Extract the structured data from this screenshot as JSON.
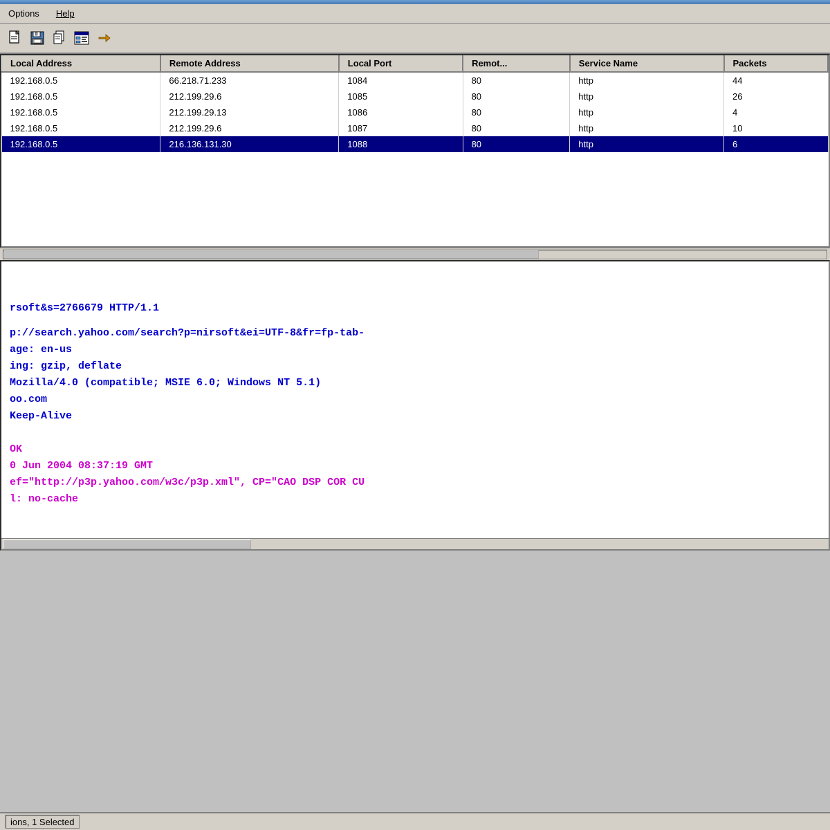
{
  "titlebar": {
    "gradient": true
  },
  "menubar": {
    "items": [
      {
        "label": "Options",
        "underline": false
      },
      {
        "label": "Help",
        "underline": true
      }
    ]
  },
  "toolbar": {
    "buttons": [
      {
        "id": "new",
        "icon": "new-doc-icon",
        "label": "New"
      },
      {
        "id": "save",
        "icon": "save-icon",
        "label": "Save"
      },
      {
        "id": "copy",
        "icon": "copy-icon",
        "label": "Copy"
      },
      {
        "id": "properties",
        "icon": "properties-icon",
        "label": "Properties"
      },
      {
        "id": "exit",
        "icon": "exit-icon",
        "label": "Exit"
      }
    ]
  },
  "table": {
    "columns": [
      {
        "id": "local_address",
        "label": "Local Address"
      },
      {
        "id": "remote_address",
        "label": "Remote Address"
      },
      {
        "id": "local_port",
        "label": "Local Port"
      },
      {
        "id": "remote_port",
        "label": "Remot..."
      },
      {
        "id": "service_name",
        "label": "Service Name"
      },
      {
        "id": "packets",
        "label": "Packets"
      }
    ],
    "rows": [
      {
        "local_address": "192.168.0.5",
        "remote_address": "66.218.71.233",
        "local_port": "1084",
        "remote_port": "80",
        "service_name": "http",
        "packets": "44",
        "selected": false
      },
      {
        "local_address": "192.168.0.5",
        "remote_address": "212.199.29.6",
        "local_port": "1085",
        "remote_port": "80",
        "service_name": "http",
        "packets": "26",
        "selected": false
      },
      {
        "local_address": "192.168.0.5",
        "remote_address": "212.199.29.13",
        "local_port": "1086",
        "remote_port": "80",
        "service_name": "http",
        "packets": "4",
        "selected": false
      },
      {
        "local_address": "192.168.0.5",
        "remote_address": "212.199.29.6",
        "local_port": "1087",
        "remote_port": "80",
        "service_name": "http",
        "packets": "10",
        "selected": false
      },
      {
        "local_address": "192.168.0.5",
        "remote_address": "216.136.131.30",
        "local_port": "1088",
        "remote_port": "80",
        "service_name": "http",
        "packets": "6",
        "selected": true
      }
    ]
  },
  "log": {
    "lines": [
      {
        "text": "rsoft&s=2766679 HTTP/1.1",
        "color": "blue"
      },
      {
        "text": "",
        "color": "empty"
      },
      {
        "text": "p://search.yahoo.com/search?p=nirsoft&ei=UTF-8&fr=fp-tab-",
        "color": "blue"
      },
      {
        "text": "age: en-us",
        "color": "blue"
      },
      {
        "text": "ing: gzip, deflate",
        "color": "blue"
      },
      {
        "text": "Mozilla/4.0 (compatible; MSIE 6.0; Windows NT 5.1)",
        "color": "blue"
      },
      {
        "text": "oo.com",
        "color": "blue"
      },
      {
        "text": "Keep-Alive",
        "color": "blue"
      },
      {
        "text": "",
        "color": "empty"
      },
      {
        "text": "",
        "color": "empty"
      },
      {
        "text": "OK",
        "color": "magenta"
      },
      {
        "text": "0 Jun 2004 08:37:19 GMT",
        "color": "magenta"
      },
      {
        "text": "ef=\"http://p3p.yahoo.com/w3c/p3p.xml\", CP=\"CAO DSP COR CU",
        "color": "magenta"
      },
      {
        "text": "l: no-cache",
        "color": "magenta"
      }
    ]
  },
  "statusbar": {
    "text": "ions, 1 Selected"
  }
}
